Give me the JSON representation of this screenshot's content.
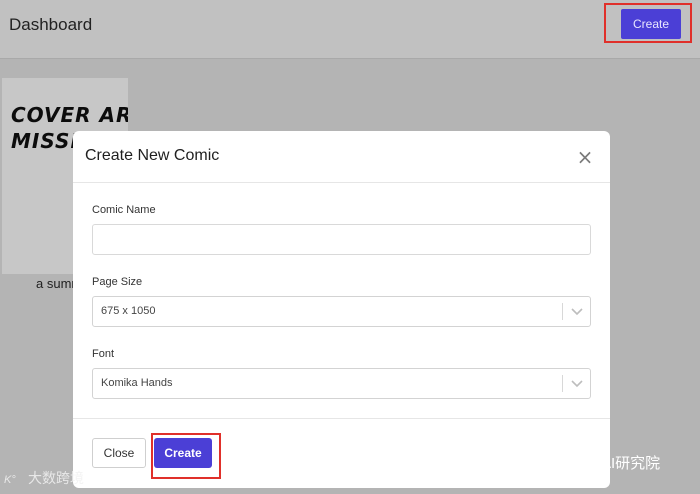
{
  "header": {
    "title": "Dashboard",
    "create_label": "Create"
  },
  "background": {
    "cover_text": "COVER ART\nMISSING",
    "summary": "a summ"
  },
  "modal": {
    "title": "Create New Comic",
    "close_icon": "close-icon",
    "fields": {
      "comic_name_label": "Comic Name",
      "comic_name_value": "",
      "page_size_label": "Page Size",
      "page_size_value": "675 x 1050",
      "font_label": "Font",
      "font_value": "Komika Hands"
    },
    "footer": {
      "close_label": "Close",
      "create_label": "Create"
    }
  },
  "watermarks": {
    "left": "大数跨境",
    "right": "人工智能AI研究院"
  },
  "colors": {
    "accent": "#4b3fd6",
    "highlight_frame": "#e0302a",
    "overlay": "#b4b4b4"
  }
}
